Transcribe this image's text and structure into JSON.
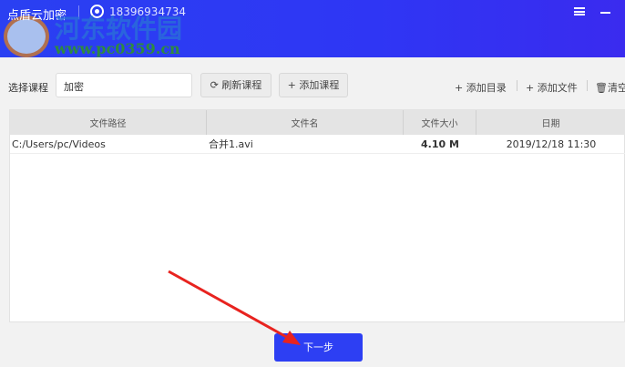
{
  "header": {
    "title": "点盾云加密",
    "phone": "18396934734",
    "watermark_cn": "河东软件园",
    "watermark_url": "www.pc0359.cn"
  },
  "toolbar": {
    "select_label": "选择课程",
    "course_value": "加密",
    "refresh_label": "刷新课程",
    "add_course_label": "+ 添加课程",
    "add_dir_label": "+ 添加目录",
    "add_file_label": "+ 添加文件",
    "clear_label": "清空"
  },
  "table": {
    "columns": [
      "文件路径",
      "文件名",
      "文件大小",
      "日期"
    ],
    "rows": [
      {
        "path": "C:/Users/pc/Videos",
        "name": "合并1.avi",
        "size": "4.10 M",
        "date": "2019/12/18 11:30"
      }
    ]
  },
  "footer": {
    "next_label": "下一步"
  },
  "colors": {
    "accent": "#2d3ff3",
    "arrow": "#e8231f"
  }
}
